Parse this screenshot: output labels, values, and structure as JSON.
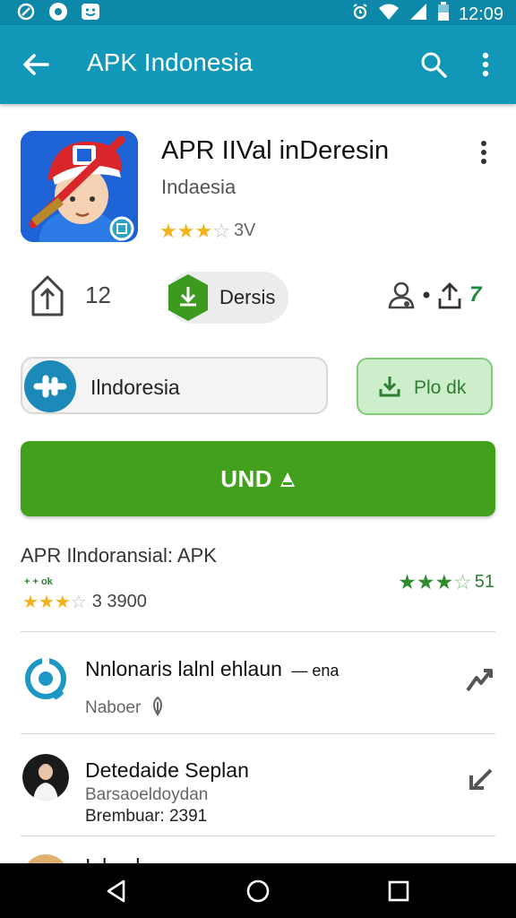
{
  "status_bar": {
    "time": "12:09"
  },
  "app_bar": {
    "title": "APK Indonesia"
  },
  "app": {
    "title": "APR IIVal inDeresin",
    "subtitle": "Indaesia",
    "rating_text": "3V",
    "stars_filled": 3,
    "stars_total": 5
  },
  "stats": {
    "count": "12",
    "pill_label": "Dersis",
    "share_label": "7"
  },
  "buttons": {
    "language_label": "Ilndoresia",
    "secondary_label": "Plo dk",
    "install_label": "UND"
  },
  "section": {
    "title": "APR Ilndoransial: APK",
    "mini_tag": "+ + ok",
    "left_rating_text": "3 3900",
    "right_rating_text": "51"
  },
  "list": [
    {
      "line1": "Nnlonaris lalnl ehlaun",
      "line1_suffix": "ena",
      "line2": "Naboer"
    },
    {
      "line1": "Detedaide Seplan",
      "line2": "Barsaoeldoydan",
      "line3": "Brembuar: 2391"
    },
    {
      "line1": "I..l.....l"
    }
  ]
}
